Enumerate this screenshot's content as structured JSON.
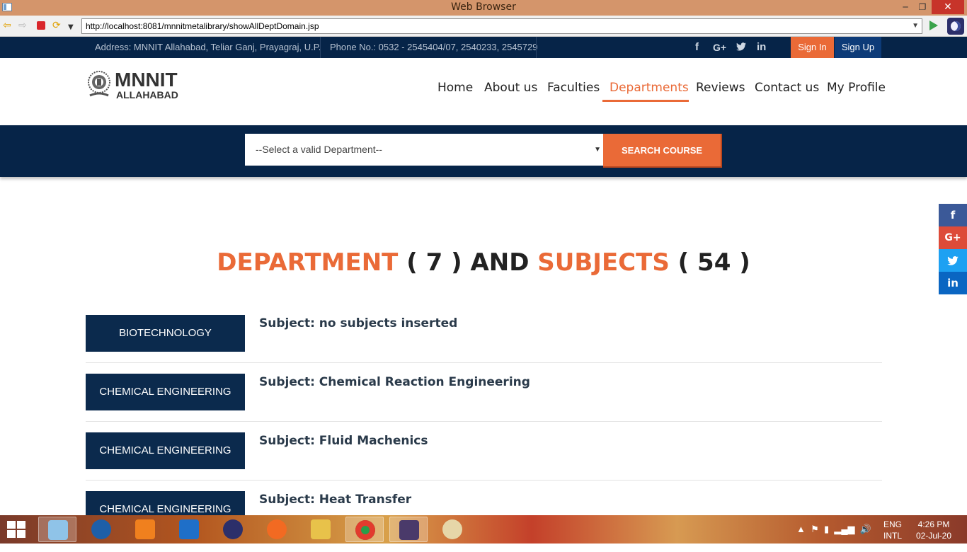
{
  "window": {
    "title": "Web Browser",
    "min": "─",
    "max": "❐",
    "close": "✕"
  },
  "browser": {
    "url": "http://localhost:8081/mnnitmetalibrary/showAllDeptDomain.jsp"
  },
  "topbar": {
    "address": "Address: MNNIT Allahabad, Teliar Ganj, Prayagraj, U.P.",
    "phone": "Phone No.: 0532 - 2545404/07, 2540233, 2545729",
    "social": {
      "facebook": "f",
      "googleplus": "G+",
      "twitter": "🐦",
      "linkedin": "in"
    },
    "signin": "Sign In",
    "signup": "Sign Up"
  },
  "logo": {
    "line1": "MNNIT",
    "line2": "ALLAHABAD"
  },
  "nav": {
    "home": "Home",
    "about": "About us",
    "faculties": "Faculties",
    "departments": "Departments",
    "reviews": "Reviews",
    "contact": "Contact us",
    "profile": "My Profile"
  },
  "search": {
    "select_value": "--Select a valid Department--",
    "button": "SEARCH COURSE"
  },
  "heading": {
    "word1": "DEPARTMENT",
    "count1": " ( 7 ) ",
    "and": "AND ",
    "word2": "SUBJECTS",
    "count2": " ( 54 )"
  },
  "rows": [
    {
      "dept": "BIOTECHNOLOGY",
      "subject": "Subject: no subjects inserted"
    },
    {
      "dept": "CHEMICAL ENGINEERING",
      "subject": "Subject: Chemical Reaction Engineering"
    },
    {
      "dept": "CHEMICAL ENGINEERING",
      "subject": "Subject: Fluid Machenics"
    },
    {
      "dept": "CHEMICAL ENGINEERING",
      "subject": "Subject: Heat Transfer"
    }
  ],
  "share": {
    "facebook": "f",
    "googleplus": "G+",
    "twitter": "🐦",
    "linkedin": "in"
  },
  "taskbar": {
    "lang1": "ENG",
    "lang2": "INTL",
    "time": "4:26 PM",
    "date": "02-Jul-20"
  },
  "colors": {
    "accent": "#ea6a37",
    "navy": "#062448",
    "dept_button": "#0b2a4d"
  }
}
